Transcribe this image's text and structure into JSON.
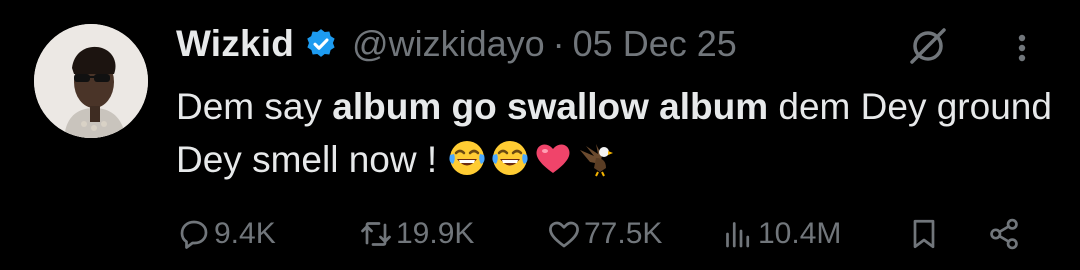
{
  "tweet": {
    "author_name": "Wizkid",
    "handle": "@wizkidayo",
    "separator": "·",
    "date": "05 Dec 25",
    "text_1": "Dem say ",
    "text_bold": "album go swallow album",
    "text_2": " dem Dey ground Dey smell now ! ",
    "emojis": [
      "face-with-tears-of-joy-icon",
      "face-with-tears-of-joy-icon",
      "red-heart-icon",
      "eagle-icon"
    ]
  },
  "metrics": {
    "replies": "9.4K",
    "reposts": "19.9K",
    "likes": "77.5K",
    "views": "10.4M"
  },
  "colors": {
    "background": "#000000",
    "text": "#e7e9ea",
    "muted": "#71767b",
    "verified": "#1d9bf0"
  }
}
